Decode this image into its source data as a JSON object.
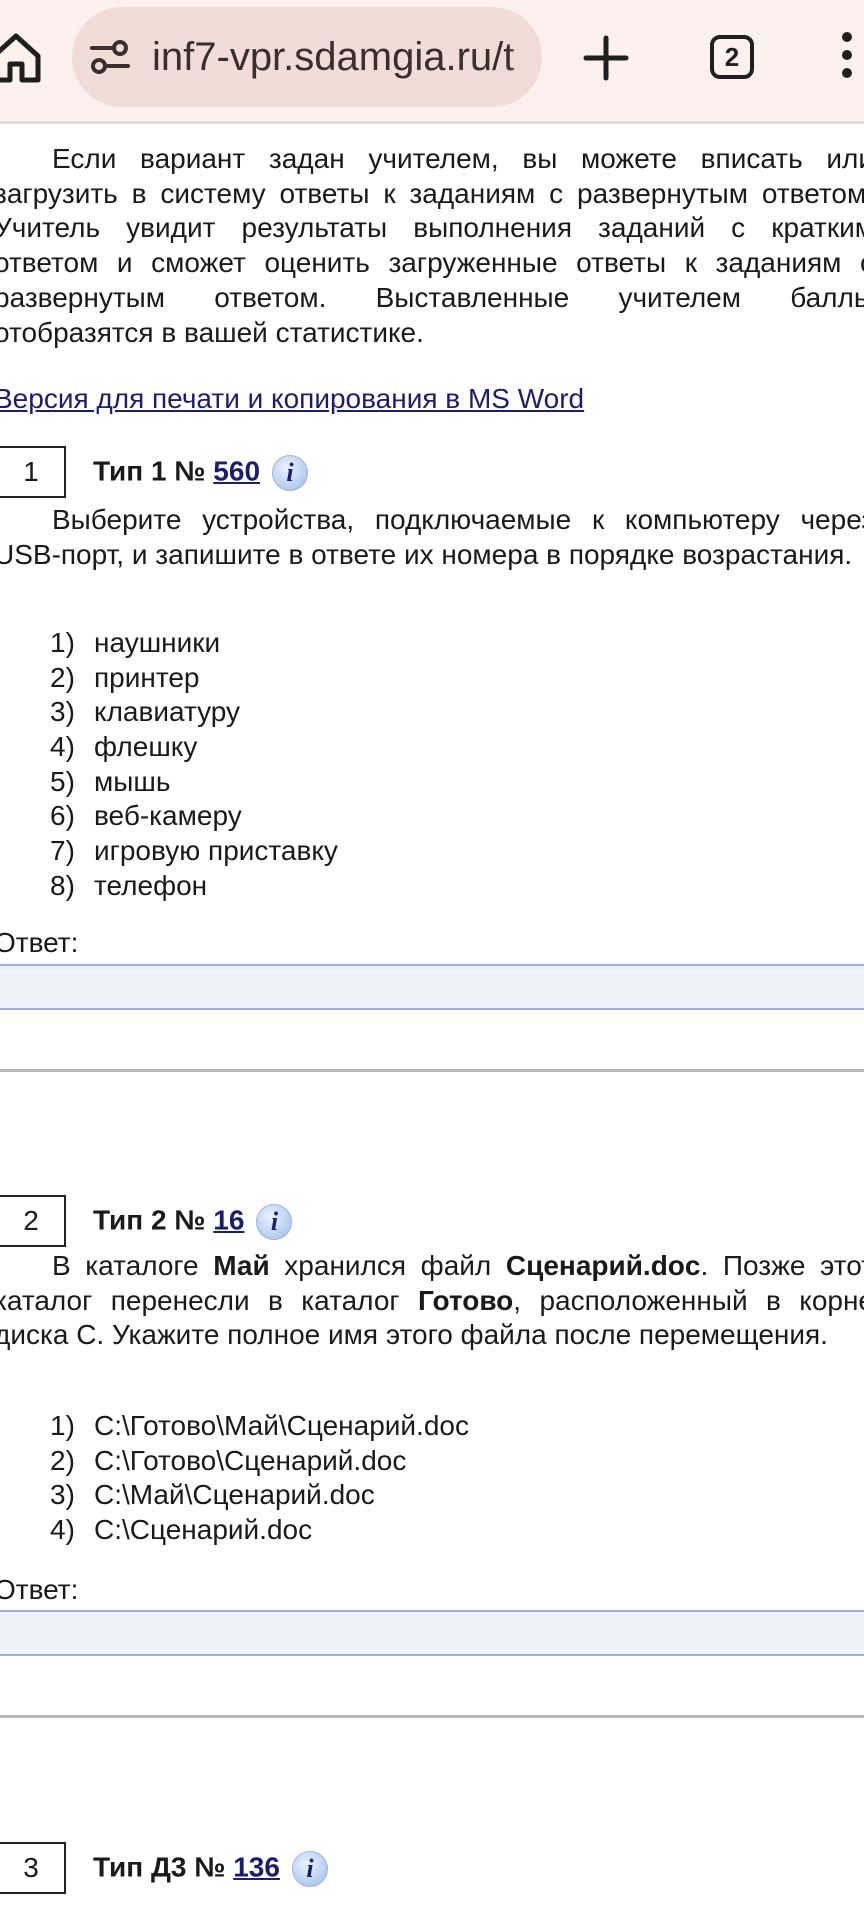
{
  "browser": {
    "url": "inf7-vpr.sdamgia.ru/t",
    "tab_count": "2"
  },
  "intro": {
    "text": "Если вариант задан учителем, вы можете вписать или загрузить в систему ответы к заданиям с развернутым ответом. Учитель увидит результаты выполнения заданий с кратким ответом и сможет оценить загруженные ответы к заданиям с развернутым ответом. Выставленные учителем баллы отобразятся в вашей статистике.",
    "print_link": "Версия для печати и копирования в MS Word"
  },
  "tasks": [
    {
      "number": "1",
      "type_label": "Тип 1 №",
      "id": "560",
      "question": "Выберите устройства, подключаемые к компьютеру через USB-порт, и запишите в ответе их номера в порядке возрастания.",
      "options": [
        {
          "n": "1)",
          "text": "наушники"
        },
        {
          "n": "2)",
          "text": "принтер"
        },
        {
          "n": "3)",
          "text": "клавиатуру"
        },
        {
          "n": "4)",
          "text": "флешку"
        },
        {
          "n": "5)",
          "text": "мышь"
        },
        {
          "n": "6)",
          "text": "веб-камеру"
        },
        {
          "n": "7)",
          "text": "игровую приставку"
        },
        {
          "n": "8)",
          "text": "телефон"
        }
      ],
      "answer_label": "Ответ:",
      "answer_value": ""
    },
    {
      "number": "2",
      "type_label": "Тип 2 №",
      "id": "16",
      "question_parts": {
        "p1": "В каталоге ",
        "b1": "Май",
        "p2": " хранился файл ",
        "b2": "Сценарий.doc",
        "p3": ". Позже этот каталог перенесли в каталог ",
        "b3": "Готово",
        "p4": ", расположенный в корне диска C. Укажите полное имя этого файла после перемещения."
      },
      "options": [
        {
          "n": "1)",
          "text": "C:\\Готово\\Май\\Сценарий.doc"
        },
        {
          "n": "2)",
          "text": "C:\\Готово\\Сценарий.doc"
        },
        {
          "n": "3)",
          "text": "C:\\Май\\Сценарий.doc"
        },
        {
          "n": "4)",
          "text": "C:\\Сценарий.doc"
        }
      ],
      "answer_label": "Ответ:",
      "answer_value": ""
    },
    {
      "number": "3",
      "type_label": "Тип Д3 №",
      "id": "136"
    }
  ],
  "icons": {
    "home": "home-icon",
    "site_info": "tune-icon",
    "new_tab": "plus-icon",
    "menu": "more-vert-icon",
    "task_info": "info-icon"
  }
}
